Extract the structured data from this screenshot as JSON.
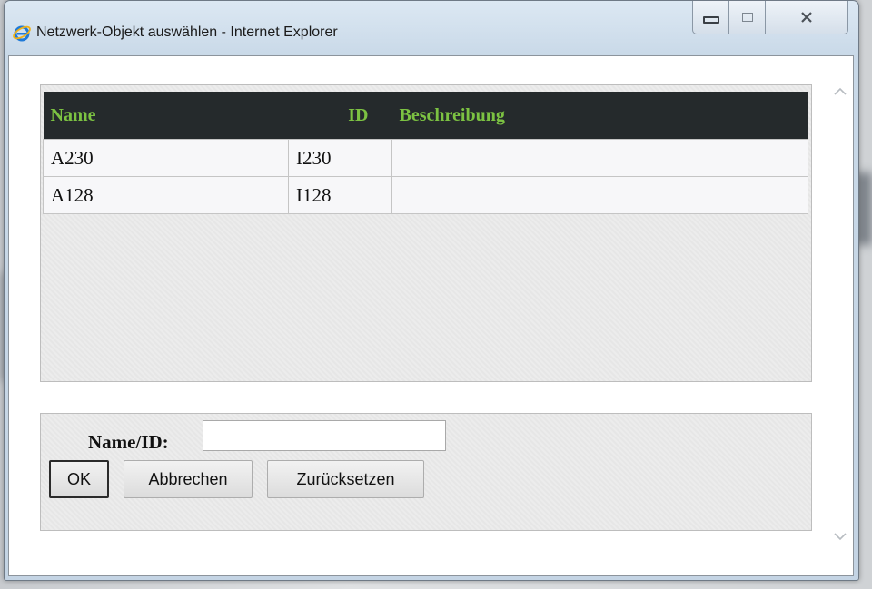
{
  "window": {
    "title": "Netzwerk-Objekt auswählen - Internet Explorer"
  },
  "table": {
    "headers": {
      "name": "Name",
      "id": "ID",
      "description": "Beschreibung"
    },
    "rows": [
      {
        "name": "A230",
        "id": "I230",
        "description": ""
      },
      {
        "name": "A128",
        "id": "I128",
        "description": ""
      }
    ]
  },
  "form": {
    "label": "Name/ID:",
    "input_value": "",
    "buttons": {
      "ok": "OK",
      "cancel": "Abbrechen",
      "reset": "Zurücksetzen"
    }
  },
  "colors": {
    "header_bg": "#252a2c",
    "header_text": "#7cc242"
  },
  "icons": [
    "internet-explorer-icon",
    "minimize-icon",
    "maximize-icon",
    "close-icon",
    "scroll-up-icon",
    "scroll-down-icon"
  ]
}
